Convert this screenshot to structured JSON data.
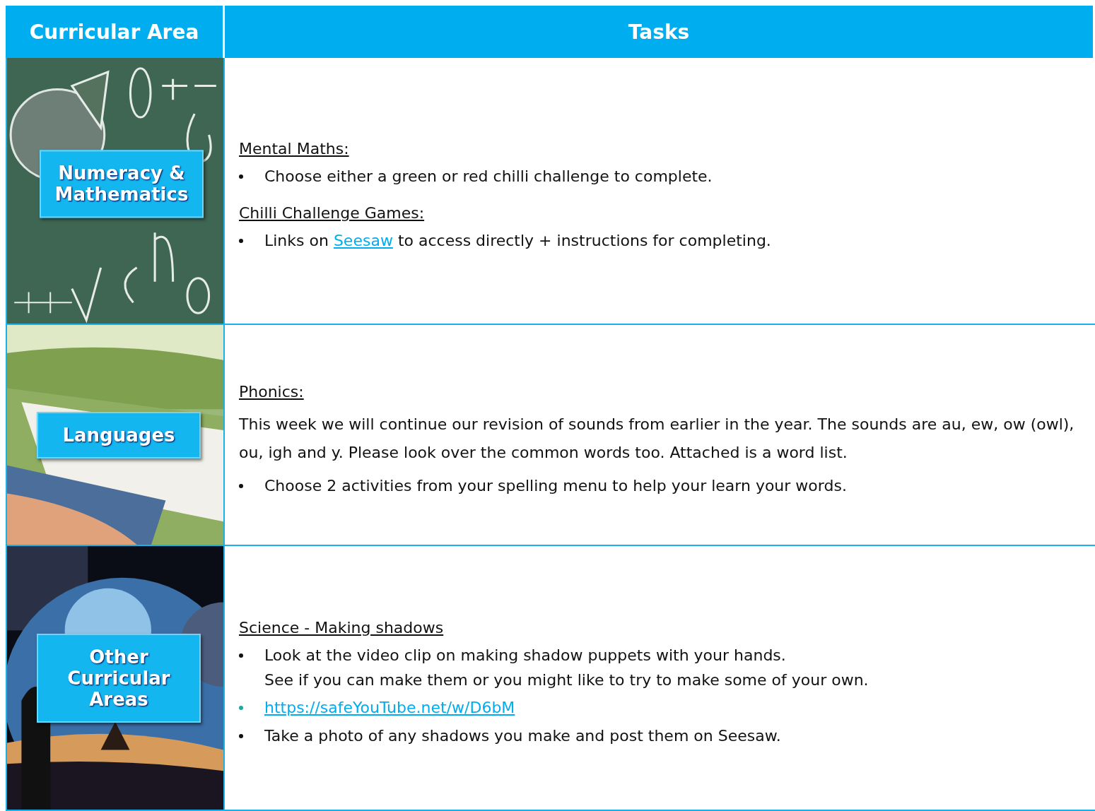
{
  "table": {
    "columns": [
      "Curricular Area",
      "Tasks"
    ],
    "rows": [
      {
        "area": "Numeracy & Mathematics",
        "picture": {
          "kind": "chalkboard"
        },
        "tasks": [
          {
            "kind": "heading",
            "text": "Mental Maths:"
          },
          {
            "kind": "bullet",
            "parts": [
              {
                "text": "Choose either a green or red chilli challenge to complete."
              }
            ]
          },
          {
            "kind": "heading",
            "text": "Chilli Challenge Games:"
          },
          {
            "kind": "bullet",
            "parts": [
              {
                "text": "Links on "
              },
              {
                "text": "Seesaw",
                "link": true
              },
              {
                "text": " to access directly + instructions for completing."
              }
            ]
          }
        ]
      },
      {
        "area": "Languages",
        "picture": {
          "kind": "field"
        },
        "tasks": [
          {
            "kind": "heading",
            "text": "Phonics:"
          },
          {
            "kind": "paragraph",
            "text": "This week we will continue our revision of sounds from earlier in the year. The sounds are au, ew, ow (owl), ou, igh and y. Please look over the common words too. Attached is a word list."
          },
          {
            "kind": "bullet",
            "parts": [
              {
                "text": "Choose 2 activities from your spelling menu to help your learn your words."
              }
            ]
          }
        ]
      },
      {
        "area": "Other Curricular Areas",
        "picture": {
          "kind": "space"
        },
        "tasks": [
          {
            "kind": "heading",
            "text": "Science - Making shadows"
          },
          {
            "kind": "bullet",
            "parts": [
              {
                "text": "Look at the video clip on making shadow puppets with your hands."
              }
            ],
            "continuation": "See if you can make them or you might like to try to make some of your own."
          },
          {
            "kind": "link",
            "text": "https://safeYouTube.net/w/D6bM"
          },
          {
            "kind": "bullet",
            "parts": [
              {
                "text": "Take a photo of any shadows you make and post them on Seesaw."
              }
            ]
          }
        ]
      }
    ]
  }
}
